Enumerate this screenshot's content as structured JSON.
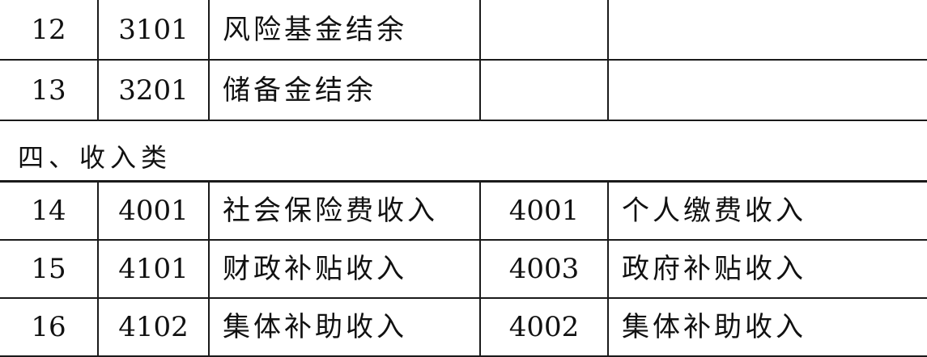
{
  "rows_top": [
    {
      "no": "12",
      "code": "3101",
      "name": "风险基金结余",
      "code2": "",
      "name2": ""
    },
    {
      "no": "13",
      "code": "3201",
      "name": "储备金结余",
      "code2": "",
      "name2": ""
    }
  ],
  "section_title": "四、收入类",
  "rows_bottom": [
    {
      "no": "14",
      "code": "4001",
      "name": "社会保险费收入",
      "code2": "4001",
      "name2": "个人缴费收入"
    },
    {
      "no": "15",
      "code": "4101",
      "name": "财政补贴收入",
      "code2": "4003",
      "name2": "政府补贴收入"
    },
    {
      "no": "16",
      "code": "4102",
      "name": "集体补助收入",
      "code2": "4002",
      "name2": "集体补助收入"
    }
  ]
}
